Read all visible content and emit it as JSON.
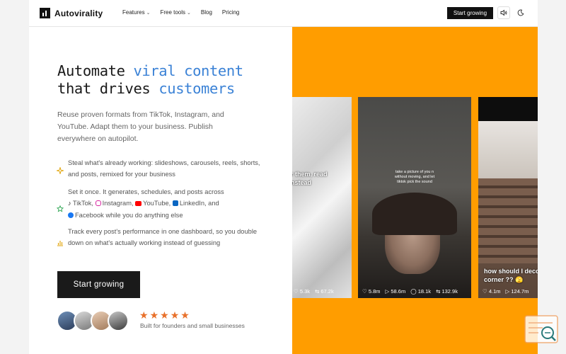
{
  "header": {
    "brand": "Autovirality",
    "nav": [
      {
        "label": "Features",
        "has_dropdown": true
      },
      {
        "label": "Free tools",
        "has_dropdown": true
      },
      {
        "label": "Blog",
        "has_dropdown": false
      },
      {
        "label": "Pricing",
        "has_dropdown": false
      }
    ],
    "cta_label": "Start growing",
    "icons": [
      "speaker-icon",
      "moon-icon"
    ]
  },
  "hero": {
    "title_part1": "Automate ",
    "title_highlight1": "viral content",
    "title_part2": "that drives ",
    "title_highlight2": "customers",
    "subtitle": "Reuse proven formats from TikTok, Instagram, and YouTube. Adapt them to your business. Publish everywhere on autopilot.",
    "features": [
      {
        "icon": "sparkle-icon",
        "text": "Steal what's already working: slideshows, carousels, reels, shorts, and posts, remixed for your business"
      },
      {
        "icon": "star-outline-icon",
        "text_start": "Set it once. It generates, schedules, and posts across",
        "platforms": [
          "TikTok,",
          "Instagram,",
          "YouTube,",
          "LinkedIn, and",
          "Facebook"
        ],
        "text_end": "while you do anything else"
      },
      {
        "icon": "bar-chart-icon",
        "text": "Track every post's performance in one dashboard, so you double down on what's actually working instead of guessing"
      }
    ],
    "cta_label": "Start growing",
    "rating_stars": 5,
    "rating_text": "Built for founders and small businesses"
  },
  "cards": [
    {
      "caption": "r them, read\nnstead",
      "stats": [
        "5.3k",
        "67.2k"
      ]
    },
    {
      "overlay": "take a picture of you n\nwithout moving, and let\ntiktok pick the sound",
      "stats": [
        "5.8m",
        "58.6m",
        "18.1k",
        "132.9k"
      ]
    },
    {
      "caption": "how should I deco\ncorner ?? 🫣",
      "stats": [
        "4.1m",
        "124.7m"
      ]
    }
  ],
  "colors": {
    "accent_blue": "#3b82d6",
    "panel_orange": "#ff9d00",
    "star_orange": "#e8702a",
    "dark": "#111111"
  }
}
